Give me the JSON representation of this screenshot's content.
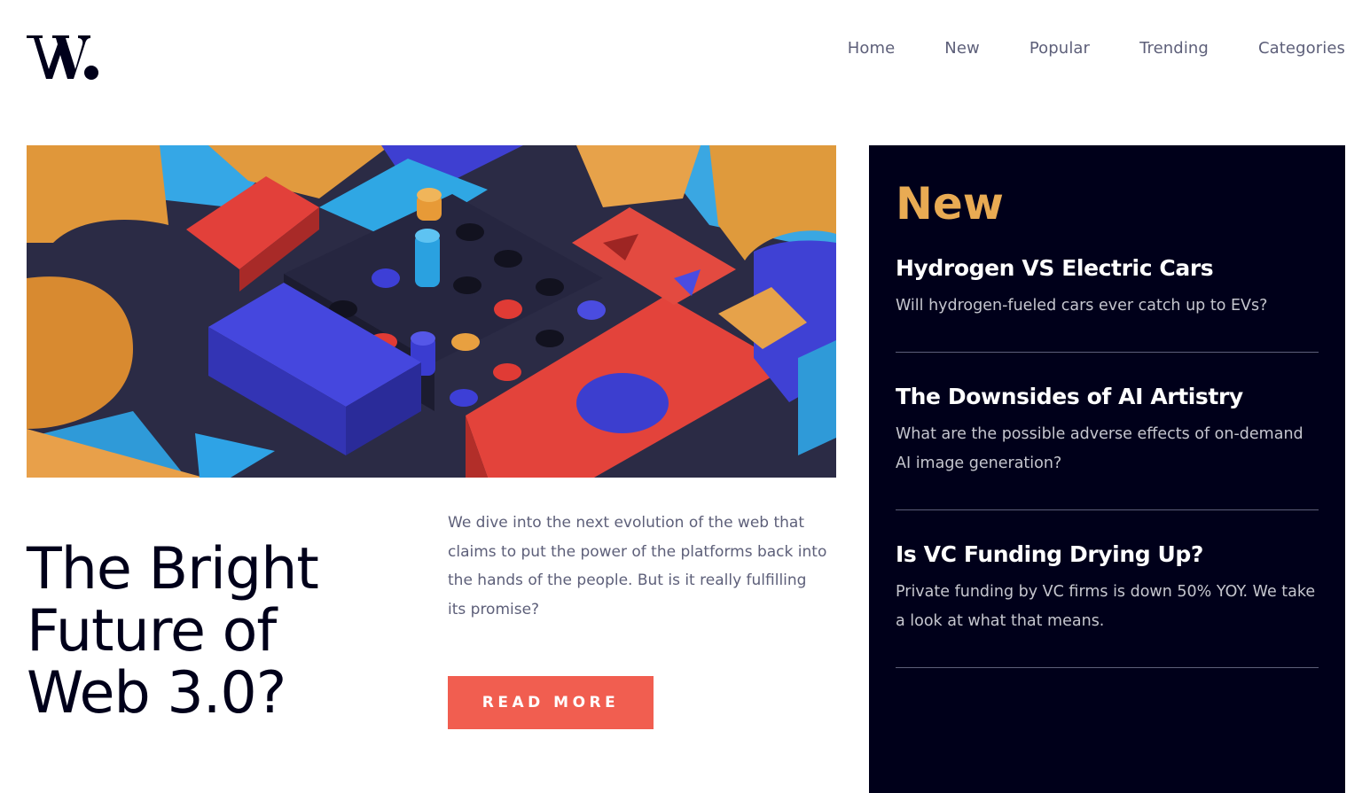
{
  "brand": {
    "logo_text": "W."
  },
  "nav": {
    "items": [
      "Home",
      "New",
      "Popular",
      "Trending",
      "Categories"
    ]
  },
  "hero": {
    "title_lines": [
      "The Bright",
      "Future of",
      "Web 3.0?"
    ],
    "description": "We dive into the next evolution of the web that claims to put the power of the platforms back into the hands of the people. But is it really fulfilling its promise?",
    "cta_label": "Read more"
  },
  "sidebar": {
    "title": "New",
    "items": [
      {
        "title": "Hydrogen VS Electric Cars",
        "summary": "Will hydrogen-fueled cars ever catch up to EVs?"
      },
      {
        "title": "The Downsides of AI Artistry",
        "summary": "What are the possible adverse effects of on-demand AI image generation?"
      },
      {
        "title": "Is VC Funding Drying Up?",
        "summary": "Private funding by VC firms is down 50% YOY. We take a look at what that means."
      }
    ]
  },
  "colors": {
    "dark_navy": "#00001a",
    "soft_orange": "#e9ab53",
    "soft_red": "#f15e50",
    "grayish_blue": "#5d5f79",
    "off_white": "#c5c6ce"
  }
}
